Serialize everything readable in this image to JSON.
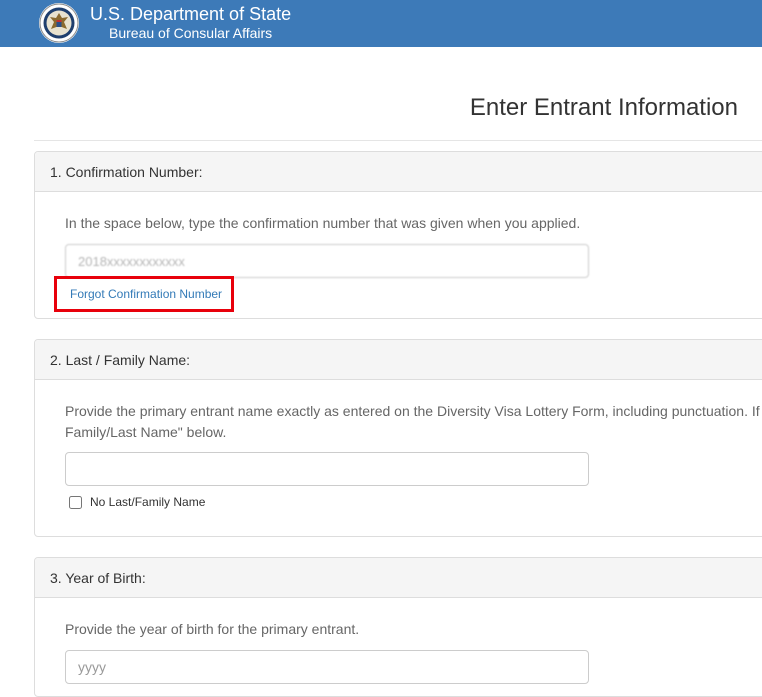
{
  "header": {
    "department": "U.S. Department of State",
    "bureau": "Bureau of Consular Affairs",
    "background_color": "#3d7ab8",
    "seal_icon": "state-department-seal-icon"
  },
  "page": {
    "title": "Enter Entrant Information"
  },
  "sections": {
    "confirmation": {
      "heading": "1. Confirmation Number:",
      "instruction": "In the space below, type the confirmation number that was given when you applied.",
      "value": "2018xxxxxxxxxxxx",
      "forgot_link": "Forgot Confirmation Number",
      "highlight_color": "#e8000b"
    },
    "last_name": {
      "heading": "2. Last / Family Name:",
      "instruction_line1": "Provide the primary entrant name exactly as entered on the Diversity Visa Lottery Form, including punctuation. If",
      "instruction_line2": "Family/Last Name\" below.",
      "value": "",
      "checkbox_label": "No Last/Family Name",
      "checkbox_checked": false
    },
    "year_of_birth": {
      "heading": "3. Year of Birth:",
      "instruction": "Provide the year of birth for the primary entrant.",
      "placeholder": "yyyy"
    }
  }
}
